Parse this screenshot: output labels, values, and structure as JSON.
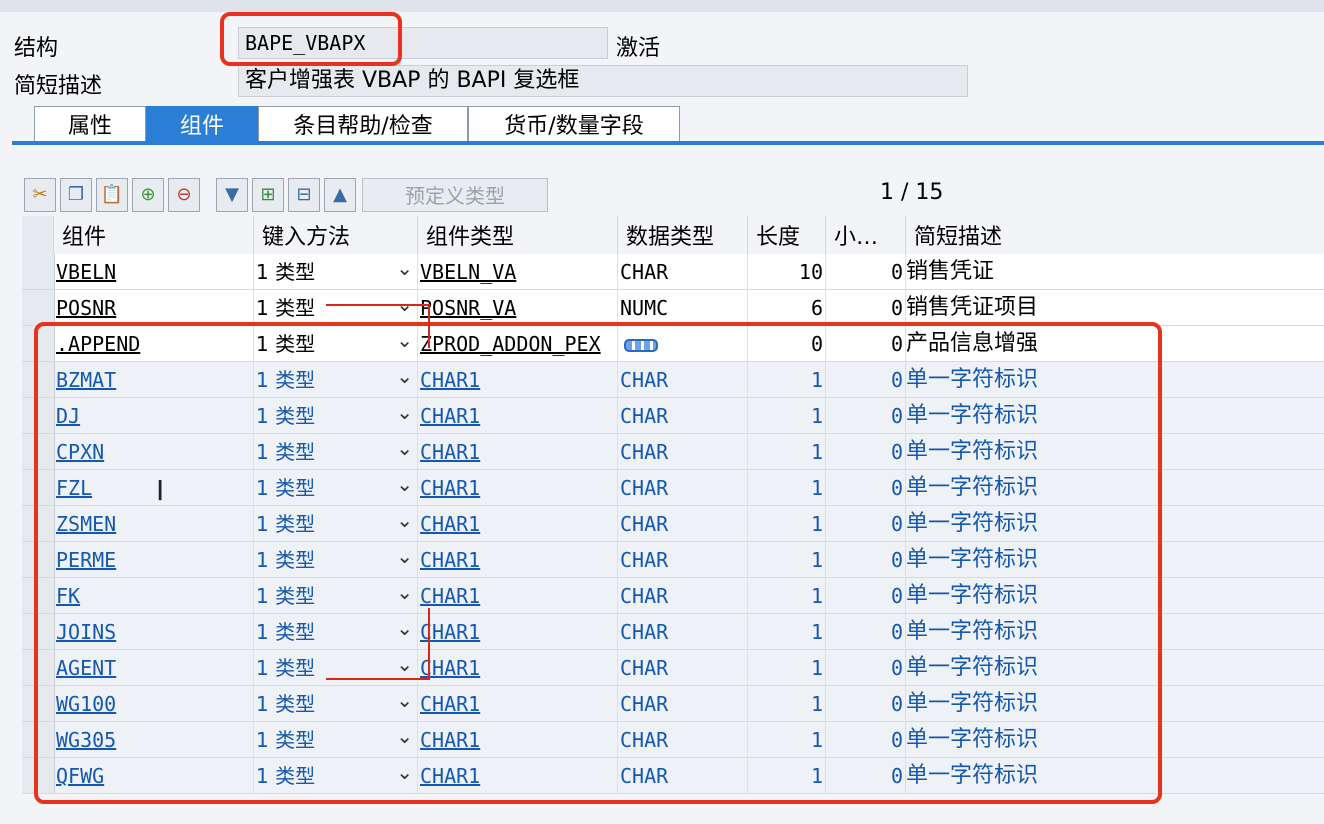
{
  "header": {
    "structure_label": "结构",
    "structure_value": "BAPE_VBAPX",
    "status": "激活",
    "short_desc_label": "简短描述",
    "short_desc_value": "客户增强表 VBAP 的 BAPI 复选框"
  },
  "tabs": [
    {
      "label": "属性"
    },
    {
      "label": "组件"
    },
    {
      "label": "条目帮助/检查"
    },
    {
      "label": "货币/数量字段"
    }
  ],
  "toolbar": {
    "predefined_type_label": "预定义类型",
    "pager": "1 / 15",
    "icons": [
      "cut-icon",
      "copy-icon",
      "paste-icon",
      "insert-row-icon",
      "delete-row-icon",
      "filter-down-icon",
      "insert-below-icon",
      "append-icon",
      "filter-up-icon"
    ]
  },
  "columns": [
    "组件",
    "键入方法",
    "组件类型",
    "数据类型",
    "长度",
    "小…",
    "简短描述"
  ],
  "rows": [
    {
      "component": "VBELN",
      "method": "1 类型",
      "comp_type": "VBELN_VA",
      "data_type": "CHAR",
      "length": "10",
      "dec": "0",
      "desc": "销售凭证"
    },
    {
      "component": "POSNR",
      "method": "1 类型",
      "comp_type": "POSNR_VA",
      "data_type": "NUMC",
      "length": "6",
      "dec": "0",
      "desc": "销售凭证项目"
    },
    {
      "component": ".APPEND",
      "method": "1 类型",
      "comp_type": "ZPROD_ADDON_PEX",
      "data_type": "",
      "length": "0",
      "dec": "0",
      "desc": "产品信息增强"
    },
    {
      "component": "BZMAT",
      "method": "1 类型",
      "comp_type": "CHAR1",
      "data_type": "CHAR",
      "length": "1",
      "dec": "0",
      "desc": "单一字符标识"
    },
    {
      "component": "DJ",
      "method": "1 类型",
      "comp_type": "CHAR1",
      "data_type": "CHAR",
      "length": "1",
      "dec": "0",
      "desc": "单一字符标识"
    },
    {
      "component": "CPXN",
      "method": "1 类型",
      "comp_type": "CHAR1",
      "data_type": "CHAR",
      "length": "1",
      "dec": "0",
      "desc": "单一字符标识"
    },
    {
      "component": "FZL",
      "method": "1 类型",
      "comp_type": "CHAR1",
      "data_type": "CHAR",
      "length": "1",
      "dec": "0",
      "desc": "单一字符标识"
    },
    {
      "component": "ZSMEN",
      "method": "1 类型",
      "comp_type": "CHAR1",
      "data_type": "CHAR",
      "length": "1",
      "dec": "0",
      "desc": "单一字符标识"
    },
    {
      "component": "PERME",
      "method": "1 类型",
      "comp_type": "CHAR1",
      "data_type": "CHAR",
      "length": "1",
      "dec": "0",
      "desc": "单一字符标识"
    },
    {
      "component": "FK",
      "method": "1 类型",
      "comp_type": "CHAR1",
      "data_type": "CHAR",
      "length": "1",
      "dec": "0",
      "desc": "单一字符标识"
    },
    {
      "component": "JOINS",
      "method": "1 类型",
      "comp_type": "CHAR1",
      "data_type": "CHAR",
      "length": "1",
      "dec": "0",
      "desc": "单一字符标识"
    },
    {
      "component": "AGENT",
      "method": "1 类型",
      "comp_type": "CHAR1",
      "data_type": "CHAR",
      "length": "1",
      "dec": "0",
      "desc": "单一字符标识"
    },
    {
      "component": "WG100",
      "method": "1 类型",
      "comp_type": "CHAR1",
      "data_type": "CHAR",
      "length": "1",
      "dec": "0",
      "desc": "单一字符标识"
    },
    {
      "component": "WG305",
      "method": "1 类型",
      "comp_type": "CHAR1",
      "data_type": "CHAR",
      "length": "1",
      "dec": "0",
      "desc": "单一字符标识"
    },
    {
      "component": "QFWG",
      "method": "1 类型",
      "comp_type": "CHAR1",
      "data_type": "CHAR",
      "length": "1",
      "dec": "0",
      "desc": "单一字符标识"
    }
  ],
  "colors": {
    "accent": "#2a7fd4",
    "highlight": "#e8321e",
    "link": "#1558b0"
  }
}
